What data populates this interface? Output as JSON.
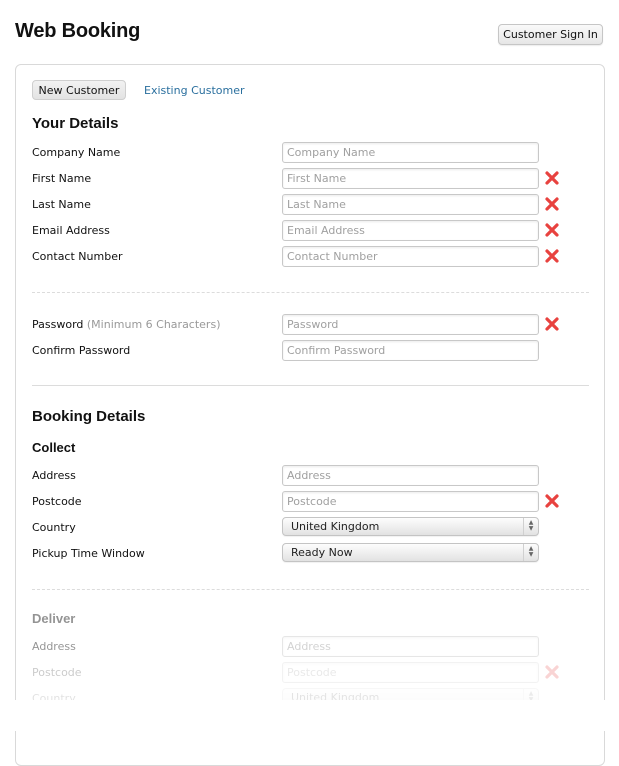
{
  "header": {
    "title": "Web Booking",
    "sign_in_label": "Customer Sign In"
  },
  "tabs": {
    "new_customer": "New Customer",
    "existing_customer": "Existing Customer"
  },
  "your_details": {
    "heading": "Your Details",
    "fields": [
      {
        "label": "Company Name",
        "placeholder": "Company Name",
        "value": "",
        "error": false
      },
      {
        "label": "First Name",
        "placeholder": "First Name",
        "value": "",
        "error": true
      },
      {
        "label": "Last Name",
        "placeholder": "Last Name",
        "value": "",
        "error": true
      },
      {
        "label": "Email Address",
        "placeholder": "Email Address",
        "value": "",
        "error": true
      },
      {
        "label": "Contact Number",
        "placeholder": "Contact Number",
        "value": "",
        "error": true
      }
    ],
    "password": {
      "label": "Password",
      "hint": "(Minimum 6 Characters)",
      "placeholder": "Password",
      "value": "",
      "error": true
    },
    "confirm_password": {
      "label": "Confirm Password",
      "placeholder": "Confirm Password",
      "value": "",
      "error": false
    }
  },
  "booking_details": {
    "heading": "Booking Details",
    "collect": {
      "heading": "Collect",
      "address": {
        "label": "Address",
        "placeholder": "Address",
        "value": "",
        "error": false
      },
      "postcode": {
        "label": "Postcode",
        "placeholder": "Postcode",
        "value": "",
        "error": true
      },
      "country": {
        "label": "Country",
        "selected": "United Kingdom"
      },
      "pickup_time_window": {
        "label": "Pickup Time Window",
        "selected": "Ready Now"
      }
    },
    "deliver": {
      "heading": "Deliver",
      "address": {
        "label": "Address",
        "placeholder": "Address",
        "value": "",
        "error": false
      },
      "postcode": {
        "label": "Postcode",
        "placeholder": "Postcode",
        "value": "",
        "error": true
      },
      "country": {
        "label": "Country",
        "selected": "United Kingdom"
      }
    }
  },
  "icons": {
    "error": "error-x-icon",
    "select_arrows": "select-arrows-icon"
  },
  "colors": {
    "link": "#2a6f9e",
    "error": "#e8423f",
    "hint": "#999999"
  }
}
